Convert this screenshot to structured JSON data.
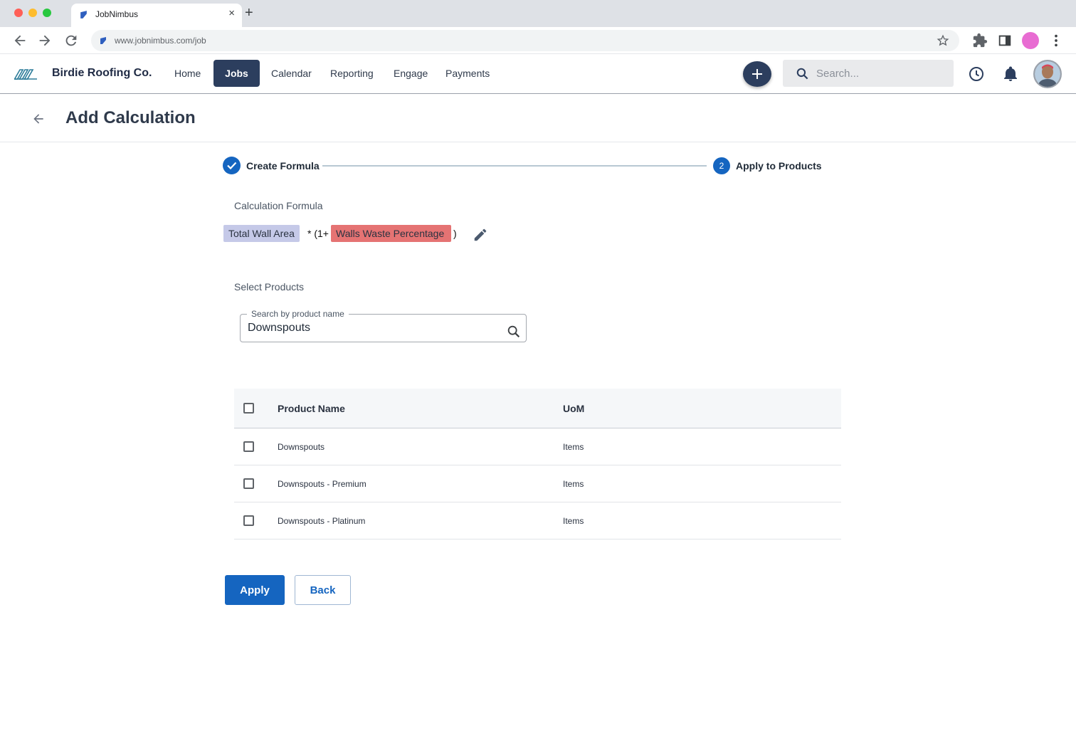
{
  "browser": {
    "tab_title": "JobNimbus",
    "url": "www.jobnimbus.com/job",
    "new_tab_symbol": "+",
    "close_symbol": "×"
  },
  "header": {
    "company": "Birdie Roofing Co.",
    "nav": [
      {
        "label": "Home",
        "active": false
      },
      {
        "label": "Jobs",
        "active": true
      },
      {
        "label": "Calendar",
        "active": false
      },
      {
        "label": "Reporting",
        "active": false
      },
      {
        "label": "Engage",
        "active": false
      },
      {
        "label": "Payments",
        "active": false
      }
    ],
    "search_placeholder": "Search...",
    "icons": [
      "add-icon",
      "search-icon",
      "history-icon",
      "bell-icon",
      "avatar"
    ]
  },
  "page": {
    "title": "Add Calculation"
  },
  "stepper": {
    "steps": [
      {
        "label": "Create Formula",
        "state": "complete"
      },
      {
        "number": "2",
        "label": "Apply to Products",
        "state": "active"
      }
    ]
  },
  "formula": {
    "label": "Calculation Formula",
    "chip1": "Total Wall Area",
    "op1": "* (1+",
    "chip2": "Walls Waste Percentage",
    "op2": ")"
  },
  "products": {
    "label": "Select Products",
    "search_legend": "Search by product name",
    "search_value": "Downspouts"
  },
  "table": {
    "headers": {
      "name": "Product Name",
      "uom": "UoM"
    },
    "rows": [
      {
        "name": "Downspouts",
        "uom": "Items"
      },
      {
        "name": "Downspouts - Premium",
        "uom": "Items"
      },
      {
        "name": "Downspouts - Platinum",
        "uom": "Items"
      }
    ]
  },
  "actions": {
    "apply": "Apply",
    "back": "Back"
  },
  "colors": {
    "primary": "#1565c0",
    "nav_active": "#2c3e5e",
    "chip_blue": "#c5c9e8",
    "chip_red": "#e57373"
  }
}
